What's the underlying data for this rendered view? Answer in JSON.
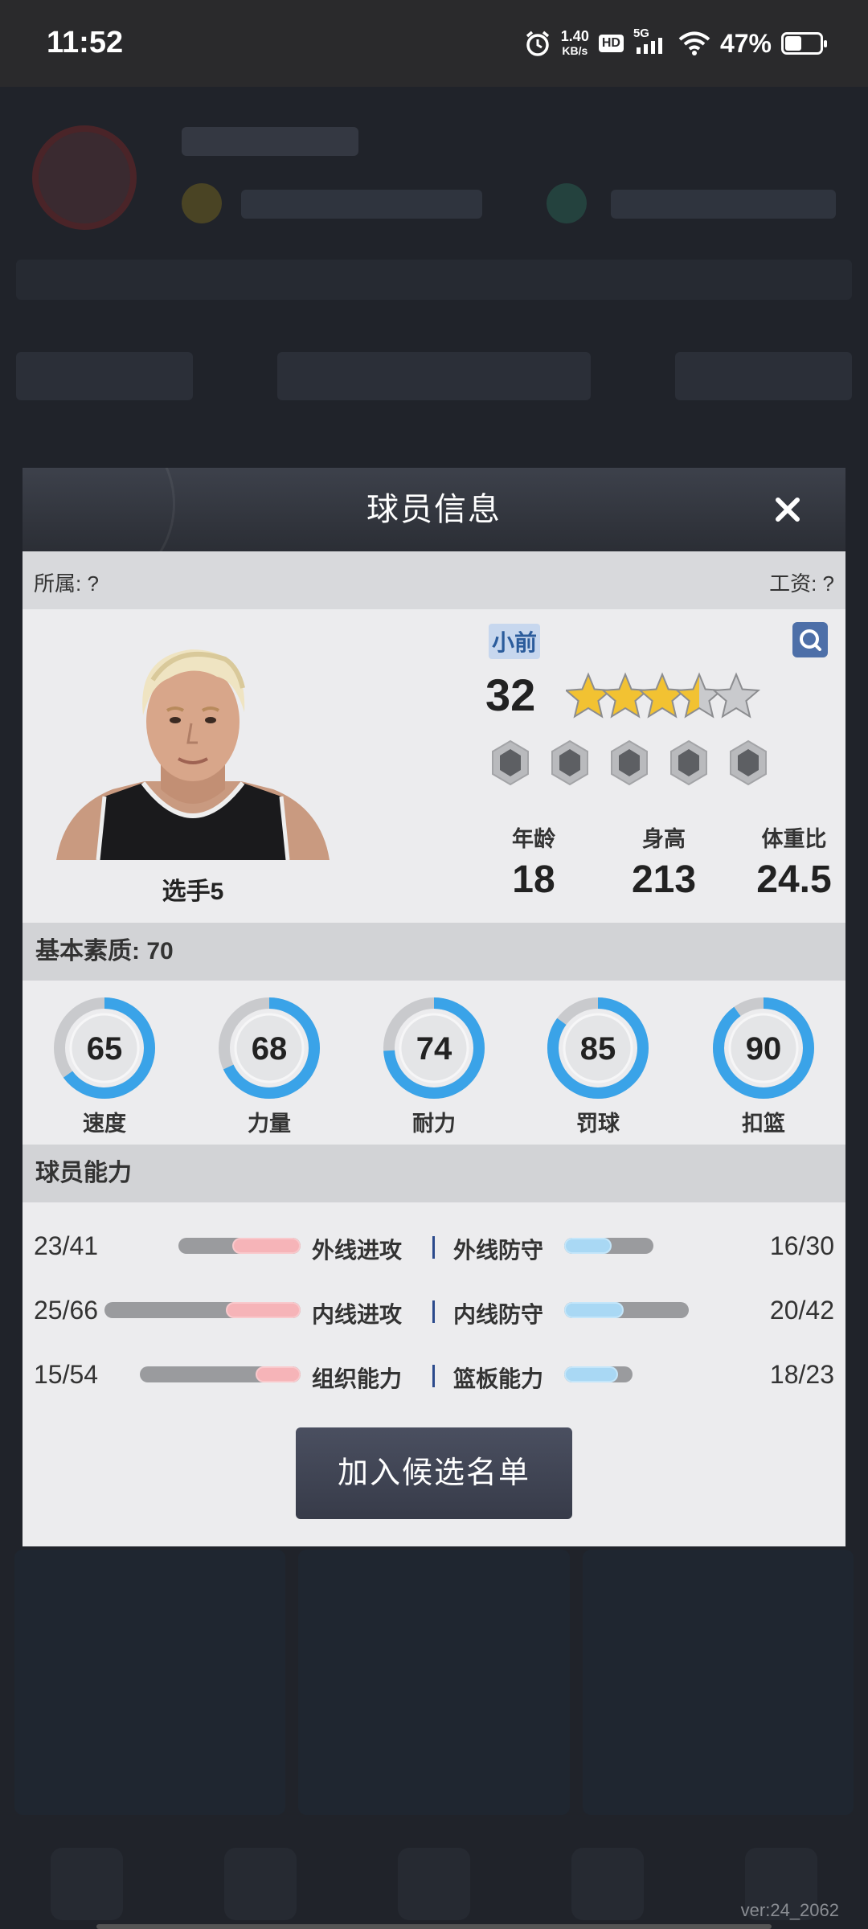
{
  "status_bar": {
    "time": "11:52",
    "net_speed_value": "1.40",
    "net_speed_unit": "KB/s",
    "hd_label": "HD",
    "signal_label": "5G",
    "battery_percent": "47%",
    "battery_level": 0.47
  },
  "modal": {
    "title": "球员信息",
    "affiliation": "所属: ?",
    "salary": "工资: ?",
    "player": {
      "name": "选手5",
      "position": "小前",
      "overall": "32",
      "star_rating": 3.5,
      "star_max": 5,
      "badge_count": 5,
      "age_label": "年龄",
      "age": "18",
      "height_label": "身高",
      "height": "213",
      "weight_label": "体重比",
      "weight": "24.5"
    },
    "basic_quality_label": "基本素质: 70",
    "rings": [
      {
        "label": "速度",
        "value": "65"
      },
      {
        "label": "力量",
        "value": "68"
      },
      {
        "label": "耐力",
        "value": "74"
      },
      {
        "label": "罚球",
        "value": "85"
      },
      {
        "label": "扣篮",
        "value": "90"
      }
    ],
    "abilities_label": "球员能力",
    "abilities": [
      {
        "left_name": "外线进攻",
        "left_value": "23/41",
        "right_name": "外线防守",
        "right_value": "16/30"
      },
      {
        "left_name": "内线进攻",
        "left_value": "25/66",
        "right_name": "内线防守",
        "right_value": "20/42"
      },
      {
        "left_name": "组织能力",
        "left_value": "15/54",
        "right_name": "篮板能力",
        "right_value": "18/23"
      }
    ],
    "add_button": "加入候选名单"
  },
  "footer": {
    "version": "ver:24_2062"
  },
  "colors": {
    "ring_blue": "#3aa3e8",
    "offense_pink": "#f6b4b8",
    "defense_blue": "#a9d8f4",
    "star_gold": "#f2c232",
    "header_dark": "#2b2e35"
  }
}
